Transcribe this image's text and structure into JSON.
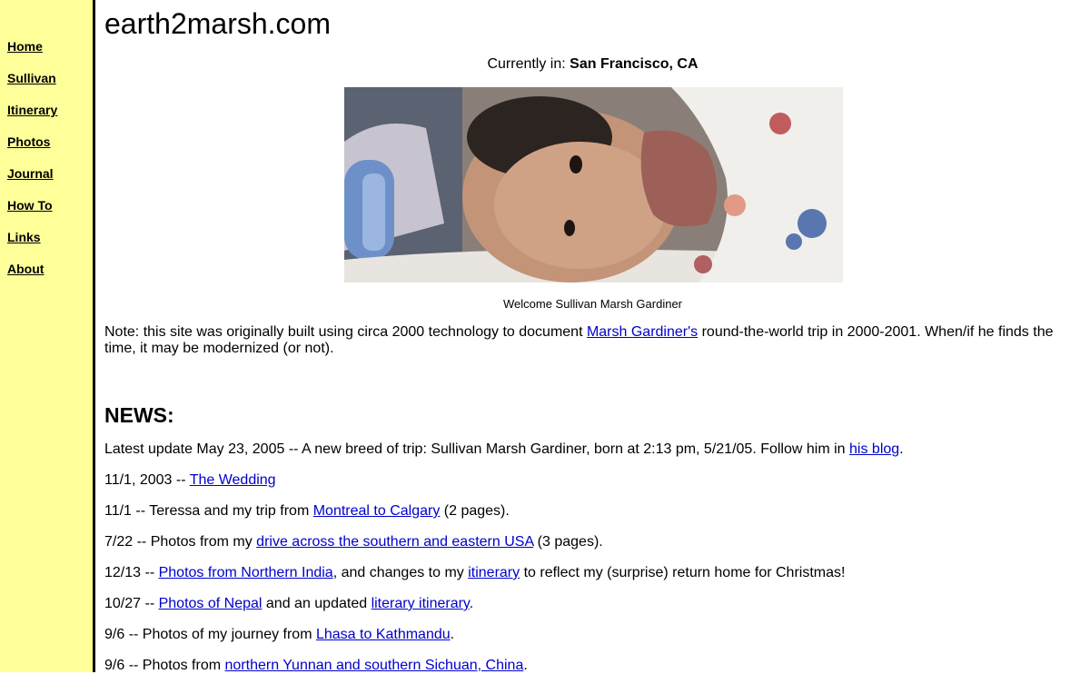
{
  "sidebar": {
    "items": [
      {
        "label": "Home"
      },
      {
        "label": "Sullivan"
      },
      {
        "label": "Itinerary"
      },
      {
        "label": "Photos"
      },
      {
        "label": "Journal"
      },
      {
        "label": "How To"
      },
      {
        "label": "Links"
      },
      {
        "label": "About"
      }
    ]
  },
  "header": {
    "title": "earth2marsh.com",
    "location_label": "Currently in:",
    "location_value": "San Francisco, CA"
  },
  "photo": {
    "caption": "Welcome Sullivan Marsh Gardiner"
  },
  "note": {
    "before": "Note: this site was originally built using circa 2000 technology to document ",
    "link": "Marsh Gardiner's",
    "after": " round-the-world trip in 2000-2001. When/if he finds the time, it may be modernized (or not)."
  },
  "news": {
    "heading": "NEWS:",
    "items": [
      {
        "before": "Latest update May 23, 2005 -- A new breed of trip: Sullivan Marsh Gardiner, born at 2:13 pm, 5/21/05. Follow him in ",
        "link": "his blog",
        "after": "."
      },
      {
        "before": "11/1, 2003 -- ",
        "link": "The Wedding",
        "after": ""
      },
      {
        "before": "11/1 -- Teressa and my trip from ",
        "link": "Montreal to Calgary",
        "after": " (2 pages)."
      },
      {
        "before": "7/22 -- Photos from my ",
        "link": "drive across the southern and eastern USA",
        "after": " (3 pages)."
      },
      {
        "before": "12/13 -- ",
        "link": "Photos from Northern India",
        "mid": ", and changes to my ",
        "link2": "itinerary",
        "after": " to reflect my (surprise) return home for Christmas!"
      },
      {
        "before": "10/27 -- ",
        "link": "Photos of Nepal",
        "mid": " and an updated ",
        "link2": "literary itinerary",
        "after": "."
      },
      {
        "before": "9/6 -- Photos of my journey from ",
        "link": "Lhasa to Kathmandu",
        "after": "."
      },
      {
        "before": "9/6 -- Photos from ",
        "link": "northern Yunnan and southern Sichuan, China",
        "after": "."
      }
    ]
  }
}
